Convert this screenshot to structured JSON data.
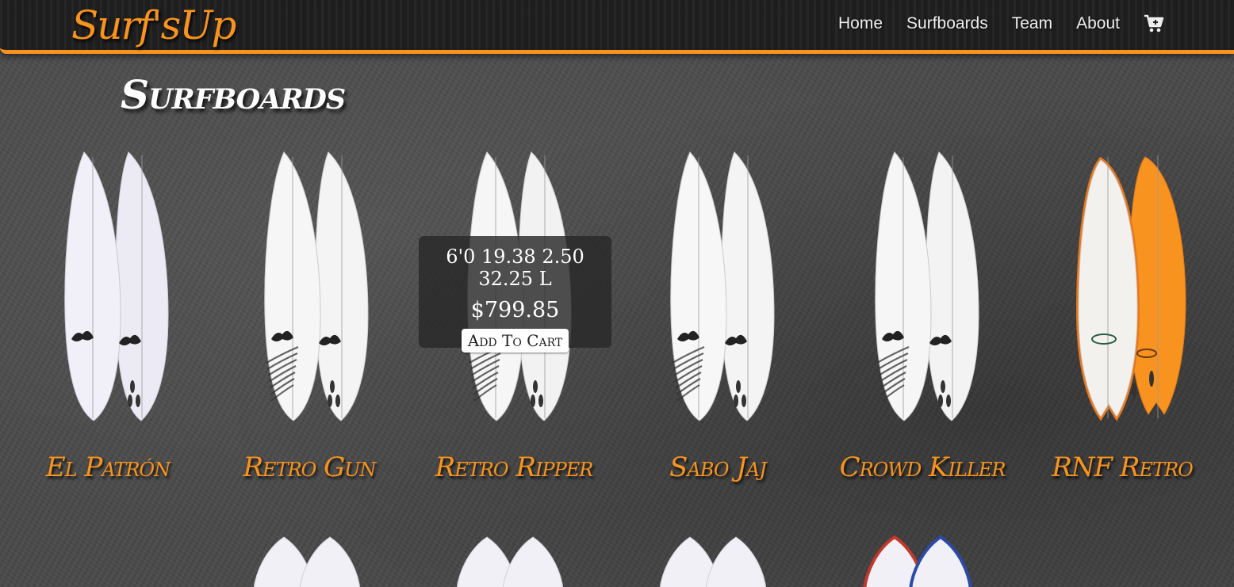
{
  "navbar": {
    "brand": "Surf'sUp",
    "links": [
      "Home",
      "Surfboards",
      "Team",
      "About"
    ],
    "cart_icon": "cart-icon"
  },
  "page": {
    "title": "Surfboards"
  },
  "boards": [
    {
      "name": "El Patrón",
      "deck": "#f1eff8",
      "bottom": "#ecebf5",
      "accent": "#3a2f55",
      "logo": "#222"
    },
    {
      "name": "Retro Gun",
      "deck": "#f6f6f6",
      "bottom": "#f4f4f4",
      "accent": "#2a2a2a",
      "logo": "#222"
    },
    {
      "name": "Retro Ripper",
      "deck": "#f6f6f6",
      "bottom": "#f2f2f2",
      "accent": "#2a2a2a",
      "logo": "#222"
    },
    {
      "name": "Sabo Jaj",
      "deck": "#f7f7f7",
      "bottom": "#f4f4f4",
      "accent": "#2a2a2a",
      "logo": "#222"
    },
    {
      "name": "Crowd Killer",
      "deck": "#f6f6f6",
      "bottom": "#f3f3f3",
      "accent": "#2a2a2a",
      "logo": "#222"
    },
    {
      "name": "RNF Retro",
      "deck": "#f3f1ee",
      "bottom": "#f7931e",
      "accent": "#e8781a",
      "logo": "#2d5a3f"
    }
  ],
  "overlay": {
    "specs": "6'0 19.38 2.50 32.25 L",
    "price": "$799.85",
    "button": "Add To Cart"
  },
  "colors": {
    "accent": "#f7931e",
    "navbar": "#1f1f1f",
    "background": "#4a4a4a"
  }
}
